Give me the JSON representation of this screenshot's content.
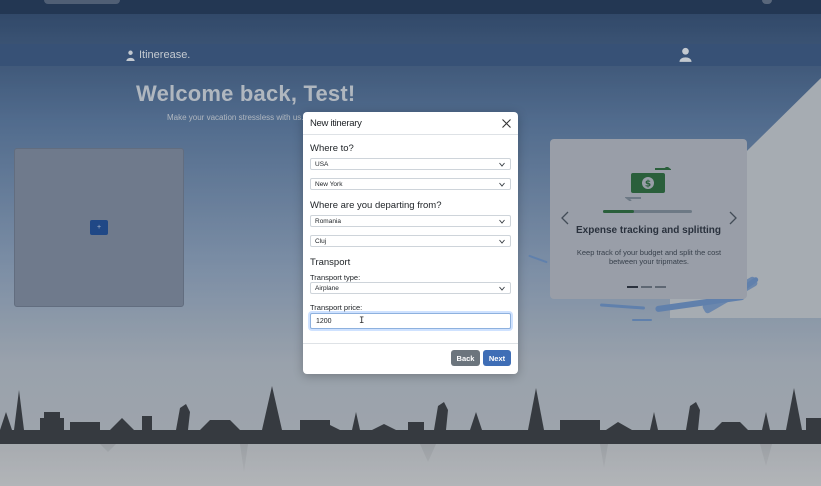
{
  "navbar": {
    "brand": "Itinerease."
  },
  "hero": {
    "welcome": "Welcome back, Test!",
    "tagline": "Make your vacation stressless with us..."
  },
  "left_card": {
    "add_button": "+"
  },
  "carousel": {
    "title": "Expense tracking and splitting",
    "text": "Keep track of your budget and split the cost between your tripmates.",
    "progress": 0.35,
    "dots": 3,
    "active_dot": 0,
    "accent_color": "#2b6b3e"
  },
  "modal": {
    "title": "New itinerary",
    "where_to": {
      "heading": "Where to?",
      "country": "USA",
      "city": "New York"
    },
    "departing": {
      "heading": "Where are you departing from?",
      "country": "Romania",
      "city": "Cluj"
    },
    "transport": {
      "heading": "Transport",
      "type_label": "Transport type:",
      "type_value": "Airplane",
      "price_label": "Transport price:",
      "price_value": "1200"
    },
    "buttons": {
      "back": "Back",
      "next": "Next"
    }
  },
  "colors": {
    "navbar": "#3b5a85",
    "primary_button": "#3f6eb6",
    "secondary_button": "#6c757d"
  }
}
